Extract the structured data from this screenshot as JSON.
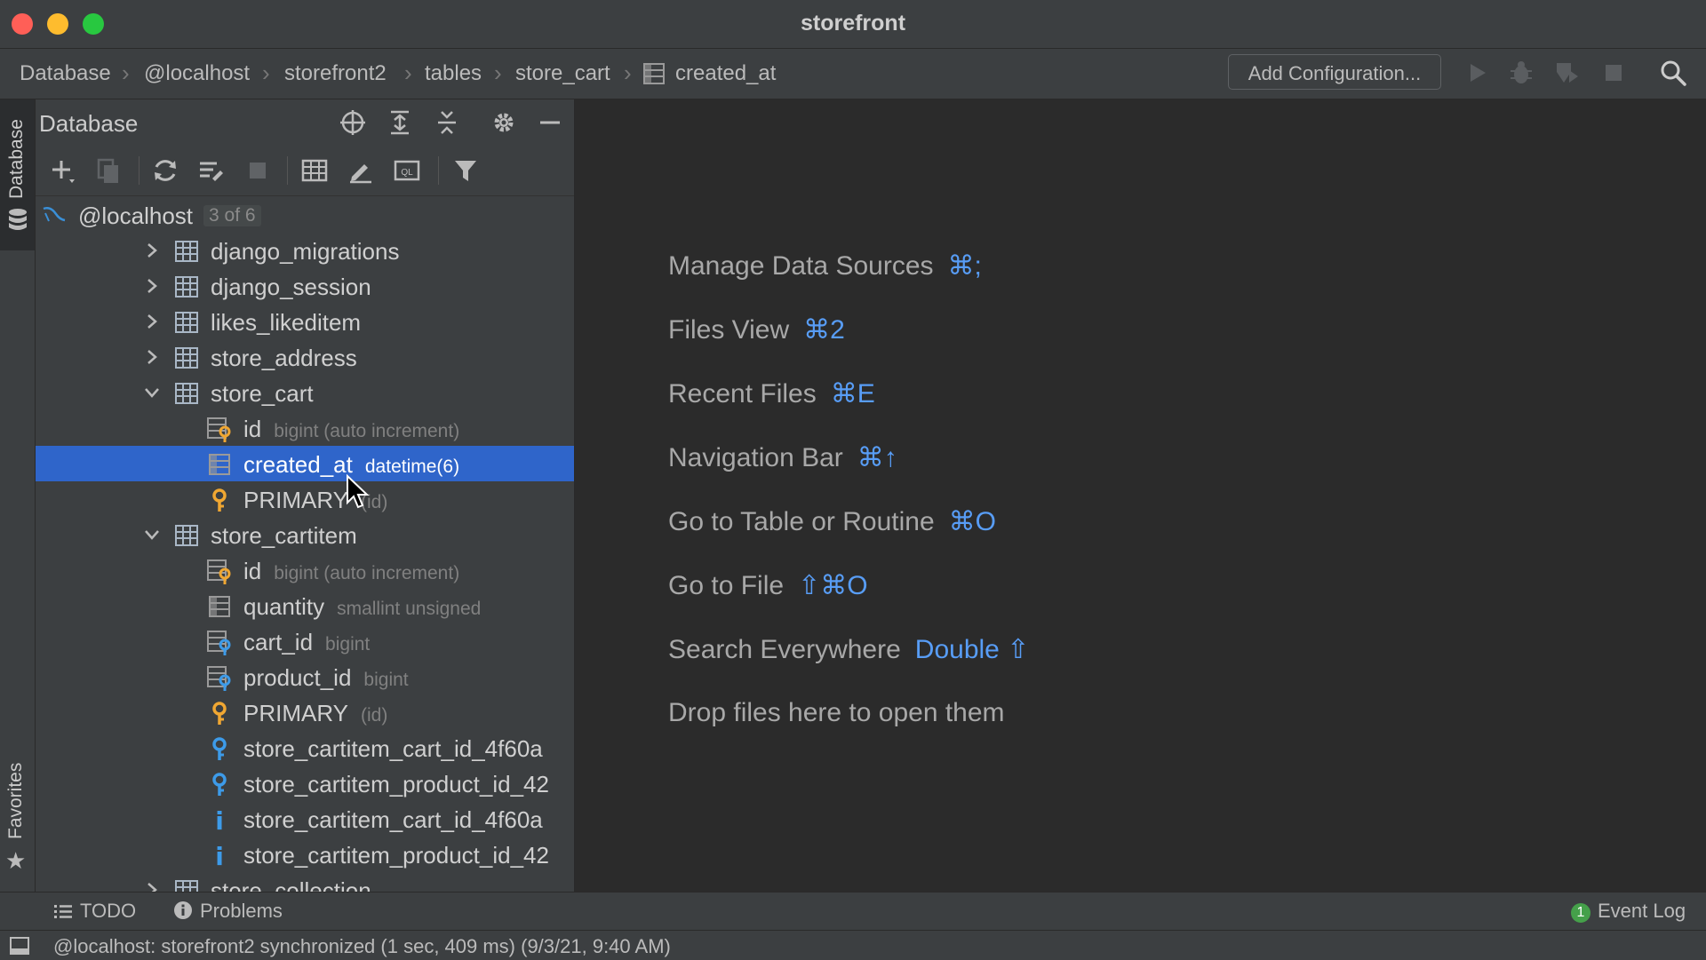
{
  "window": {
    "title": "storefront"
  },
  "breadcrumbs": [
    "Database",
    "@localhost",
    "storefront2",
    "tables",
    "store_cart",
    "created_at"
  ],
  "navbar": {
    "add_config_label": "Add Configuration..."
  },
  "sidebar": {
    "database_tab": "Database",
    "favorites_tab": "Favorites"
  },
  "panel": {
    "title": "Database",
    "header_icons": [
      "crosshair-icon",
      "expand-all-icon",
      "collapse-all-icon",
      "gear-icon",
      "minimize-icon"
    ],
    "toolbar_icons": [
      "add-icon",
      "duplicate-icon",
      "refresh-icon",
      "properties-icon",
      "stop-icon",
      "table-view-icon",
      "edit-icon",
      "query-console-icon",
      "filter-icon"
    ]
  },
  "tree": {
    "root": {
      "label": "@localhost",
      "badge": "3 of 6"
    },
    "rows": [
      {
        "label": "django_migrations",
        "type": "",
        "icon": "table",
        "indent": 1,
        "arrow": "right",
        "selected": false
      },
      {
        "label": "django_session",
        "type": "",
        "icon": "table",
        "indent": 1,
        "arrow": "right",
        "selected": false
      },
      {
        "label": "likes_likeditem",
        "type": "",
        "icon": "table",
        "indent": 1,
        "arrow": "right",
        "selected": false
      },
      {
        "label": "store_address",
        "type": "",
        "icon": "table",
        "indent": 1,
        "arrow": "right",
        "selected": false
      },
      {
        "label": "store_cart",
        "type": "",
        "icon": "table",
        "indent": 1,
        "arrow": "down",
        "selected": false
      },
      {
        "label": "id",
        "type": "bigint (auto increment)",
        "icon": "pk-column",
        "indent": 2,
        "arrow": "",
        "selected": false
      },
      {
        "label": "created_at",
        "type": "datetime(6)",
        "icon": "column",
        "indent": 2,
        "arrow": "",
        "selected": true
      },
      {
        "label": "PRIMARY",
        "type": "(id)",
        "icon": "primary-key",
        "indent": 2,
        "arrow": "",
        "selected": false
      },
      {
        "label": "store_cartitem",
        "type": "",
        "icon": "table",
        "indent": 1,
        "arrow": "down",
        "selected": false
      },
      {
        "label": "id",
        "type": "bigint (auto increment)",
        "icon": "pk-column",
        "indent": 2,
        "arrow": "",
        "selected": false
      },
      {
        "label": "quantity",
        "type": "smallint unsigned",
        "icon": "column",
        "indent": 2,
        "arrow": "",
        "selected": false
      },
      {
        "label": "cart_id",
        "type": "bigint",
        "icon": "fk-column",
        "indent": 2,
        "arrow": "",
        "selected": false
      },
      {
        "label": "product_id",
        "type": "bigint",
        "icon": "fk-column",
        "indent": 2,
        "arrow": "",
        "selected": false
      },
      {
        "label": "PRIMARY",
        "type": "(id)",
        "icon": "primary-key",
        "indent": 2,
        "arrow": "",
        "selected": false
      },
      {
        "label": "store_cartitem_cart_id_4f60a",
        "type": "",
        "icon": "foreign-key",
        "indent": 2,
        "arrow": "",
        "selected": false
      },
      {
        "label": "store_cartitem_product_id_42",
        "type": "",
        "icon": "foreign-key",
        "indent": 2,
        "arrow": "",
        "selected": false
      },
      {
        "label": "store_cartitem_cart_id_4f60a",
        "type": "",
        "icon": "index",
        "indent": 2,
        "arrow": "",
        "selected": false
      },
      {
        "label": "store_cartitem_product_id_42",
        "type": "",
        "icon": "index",
        "indent": 2,
        "arrow": "",
        "selected": false
      },
      {
        "label": "store_collection",
        "type": "",
        "icon": "table",
        "indent": 1,
        "arrow": "right",
        "selected": false
      }
    ]
  },
  "editor_hints": [
    {
      "label": "Manage Data Sources",
      "shortcut": "⌘;"
    },
    {
      "label": "Files View",
      "shortcut": "⌘2"
    },
    {
      "label": "Recent Files",
      "shortcut": "⌘E"
    },
    {
      "label": "Navigation Bar",
      "shortcut": "⌘↑"
    },
    {
      "label": "Go to Table or Routine",
      "shortcut": "⌘O"
    },
    {
      "label": "Go to File",
      "shortcut": "⇧⌘O"
    },
    {
      "label": "Search Everywhere",
      "shortcut": "Double ⇧"
    },
    {
      "label": "Drop files here to open them",
      "shortcut": ""
    }
  ],
  "toolwindows": {
    "todo": "TODO",
    "problems": "Problems",
    "event_log": "Event Log",
    "event_count": "1"
  },
  "status": {
    "text": "@localhost: storefront2 synchronized (1 sec, 409 ms) (9/3/21, 9:40 AM)"
  },
  "colors": {
    "accent": "#589df6",
    "selection": "#2f65ca",
    "panel": "#3c3f41",
    "editor": "#2b2b2b",
    "key_icon": "#f0a732"
  }
}
